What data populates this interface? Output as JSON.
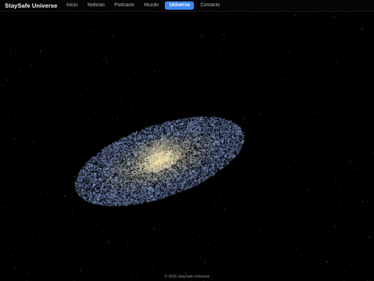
{
  "header": {
    "brand": "StaySafe Universe",
    "nav": [
      {
        "label": "Inicio",
        "active": false
      },
      {
        "label": "Noticias",
        "active": false
      },
      {
        "label": "Podcasts",
        "active": false
      },
      {
        "label": "Mundo",
        "active": false
      },
      {
        "label": "Universo",
        "active": true
      },
      {
        "label": "Contacto",
        "active": false
      }
    ]
  },
  "colors": {
    "background": "#000000",
    "accent": "#3f86f0",
    "galaxy_core": "#f4e2a8",
    "galaxy_outer": "#9ab6f2"
  },
  "footer": {
    "text": "© 2025 StaySafe Universe"
  }
}
